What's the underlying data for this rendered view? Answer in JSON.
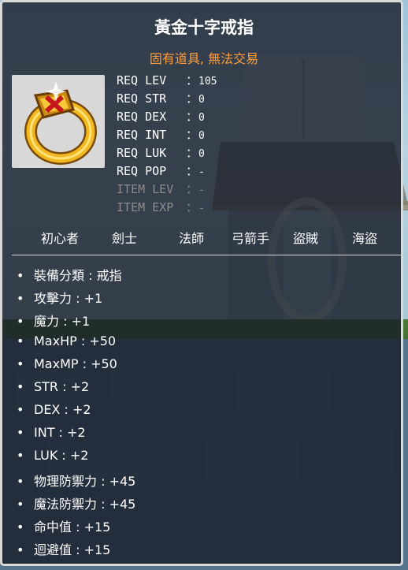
{
  "item": {
    "name": "黃金十字戒指",
    "tags": "固有道具, 無法交易",
    "icon": "gold-cross-ring-icon"
  },
  "requirements": [
    {
      "label": "REQ LEV",
      "value": "105",
      "dim": false
    },
    {
      "label": "REQ STR",
      "value": "0",
      "dim": false
    },
    {
      "label": "REQ DEX",
      "value": "0",
      "dim": false
    },
    {
      "label": "REQ INT",
      "value": "0",
      "dim": false
    },
    {
      "label": "REQ LUK",
      "value": "0",
      "dim": false
    },
    {
      "label": "REQ POP",
      "value": "-",
      "dim": false
    },
    {
      "label": "ITEM LEV",
      "value": "-",
      "dim": true
    },
    {
      "label": "ITEM EXP",
      "value": "-",
      "dim": true
    }
  ],
  "separator": "：",
  "jobs": [
    "初心者",
    "劍士",
    "法師",
    "弓箭手",
    "盜賊",
    "海盜"
  ],
  "bullet": "•",
  "stats": [
    "裝備分類 : 戒指",
    "攻擊力 : +1",
    "魔力 : +1",
    "MaxHP : +50",
    "MaxMP : +50",
    "STR : +2",
    "DEX : +2",
    "INT : +2",
    "LUK : +2",
    "物理防禦力 : +45",
    "魔法防禦力 : +45",
    "命中值 : +15",
    "迴避值 : +15"
  ],
  "colors": {
    "title": "#ffffff",
    "tags": "#ff9d3c",
    "dim_text": "#8c8c8c",
    "panel_border": "#d9d9d9"
  }
}
